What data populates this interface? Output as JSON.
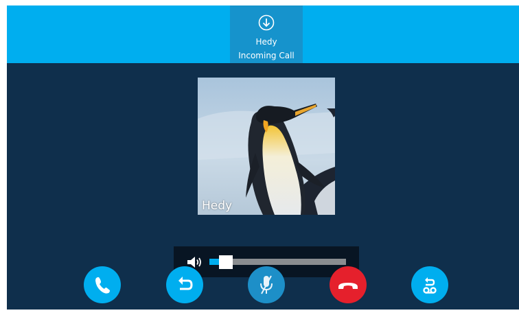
{
  "call": {
    "caller_name": "Hedy",
    "status": "Incoming Call",
    "photo_caption": "Hedy"
  },
  "volume": {
    "level": 0.12
  },
  "buttons": [
    {
      "name": "answer",
      "icon": "phone-icon"
    },
    {
      "name": "forward",
      "icon": "forward-arrow-icon"
    },
    {
      "name": "mute",
      "icon": "mic-muted-icon"
    },
    {
      "name": "reject",
      "icon": "hang-up-icon"
    },
    {
      "name": "voicemail",
      "icon": "voicemail-icon"
    }
  ],
  "colors": {
    "accent": "#00aeef",
    "background": "#0f2f4c",
    "reject": "#e5202c"
  }
}
